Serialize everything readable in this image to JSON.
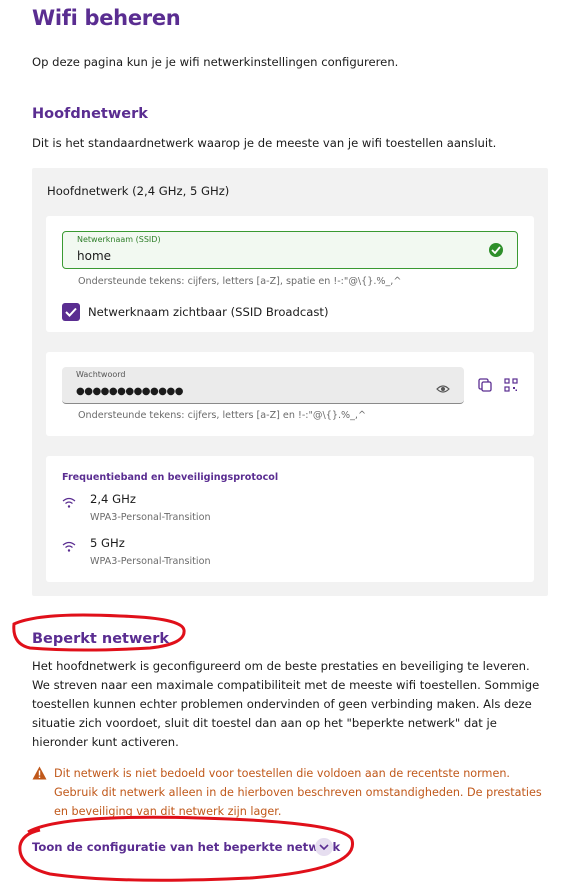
{
  "page": {
    "title": "Wifi beheren",
    "intro": "Op deze pagina kun je je wifi netwerkinstellingen configureren."
  },
  "main_network": {
    "heading": "Hoofdnetwerk",
    "description": "Dit is het standaardnetwerk waarop je de meeste van je wifi toestellen aansluit.",
    "card_title": "Hoofdnetwerk (2,4 GHz, 5 GHz)",
    "ssid": {
      "label": "Netwerknaam (SSID)",
      "value": "home",
      "hint": "Ondersteunde tekens: cijfers, letters [a-Z], spatie en !-:\"@\\{}.%_,^"
    },
    "broadcast": {
      "label": "Netwerknaam zichtbaar (SSID Broadcast)",
      "checked": true
    },
    "password": {
      "label": "Wachtwoord",
      "value": "●●●●●●●●●●●●●",
      "hint": "Ondersteunde tekens: cijfers, letters [a-Z] en !-:\"@\\{}.%_,^"
    },
    "frequency": {
      "title": "Frequentieband en beveiligingsprotocol",
      "bands": [
        {
          "name": "2,4 GHz",
          "protocol": "WPA3-Personal-Transition"
        },
        {
          "name": "5 GHz",
          "protocol": "WPA3-Personal-Transition"
        }
      ]
    }
  },
  "restricted_network": {
    "heading": "Beperkt netwerk",
    "description": "Het hoofdnetwerk is geconfigureerd om de beste prestaties en beveiliging te leveren. We streven naar een maximale compatibiliteit met de meeste wifi toestellen. Sommige toestellen kunnen echter problemen ondervinden of geen verbinding maken. Als deze situatie zich voordoet, sluit dit toestel dan aan op het \"beperkte netwerk\" dat je hieronder kunt activeren.",
    "warning": "Dit netwerk is niet bedoeld voor toestellen die voldoen aan de recentste normen. Gebruik dit netwerk alleen in de hierboven beschreven omstandigheden. De prestaties en beveiliging van dit netwerk zijn lager.",
    "toggle_label": "Toon de configuratie van het beperkte netwerk"
  },
  "icons": {
    "valid": "check-circle-icon",
    "checkbox": "check-icon",
    "password_visibility": "eye-icon",
    "copy": "copy-icon",
    "qr": "qr-code-icon",
    "band": "wifi-icon",
    "warning": "warning-triangle-icon",
    "expand": "chevron-down-icon"
  },
  "colors": {
    "brand": "#5a2d91",
    "valid": "#2e8f2a",
    "warning": "#c0581a",
    "annotation": "#e0101a"
  }
}
